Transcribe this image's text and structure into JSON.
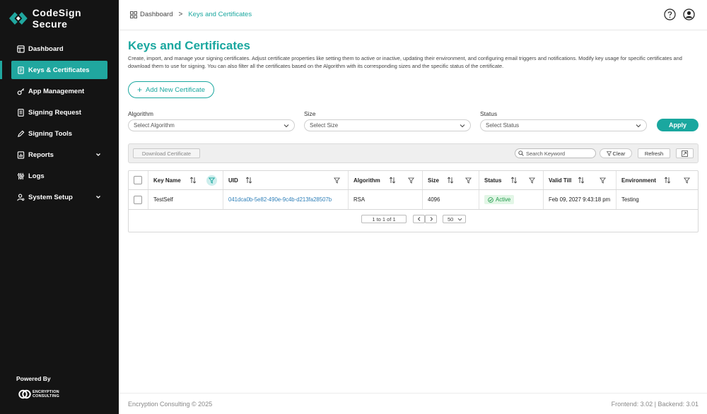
{
  "brand": {
    "name": "CodeSign Secure"
  },
  "sidebar": {
    "items": [
      {
        "label": "Dashboard",
        "icon": "dashboard-icon"
      },
      {
        "label": "Keys & Certificates",
        "icon": "keys-icon",
        "active": true
      },
      {
        "label": "App Management",
        "icon": "key-icon"
      },
      {
        "label": "Signing Request",
        "icon": "document-icon"
      },
      {
        "label": "Signing Tools",
        "icon": "pen-icon"
      },
      {
        "label": "Reports",
        "icon": "chart-icon",
        "expandable": true
      },
      {
        "label": "Logs",
        "icon": "logs-icon"
      },
      {
        "label": "System Setup",
        "icon": "user-gear-icon",
        "expandable": true
      }
    ],
    "powered_by": "Powered By",
    "partner_logo": {
      "line1": "ENCRYPTION",
      "line2": "CONSULTING"
    }
  },
  "breadcrumb": {
    "home": "Dashboard",
    "separator": ">",
    "current": "Keys and Certificates"
  },
  "page": {
    "title": "Keys and Certificates",
    "description": "Create, import, and manage your signing certificates. Adjust certificate properties like setting them to active or inactive, updating their environment, and configuring email triggers and notifications. Modify key usage for specific certificates and download them to use for signing. You can also filter all the certificates based on the Algorithm with its corresponding sizes and the specific status of the certificate.",
    "add_button": "Add New Certificate"
  },
  "filters": {
    "algorithm": {
      "label": "Algorithm",
      "placeholder": "Select Algorithm"
    },
    "size": {
      "label": "Size",
      "placeholder": "Select Size"
    },
    "status": {
      "label": "Status",
      "placeholder": "Select Status"
    },
    "apply": "Apply"
  },
  "toolbar": {
    "download": "Download Certificate",
    "search_placeholder": "Search Keyword",
    "clear": "Clear",
    "refresh": "Refresh"
  },
  "table": {
    "columns": [
      "Key Name",
      "UID",
      "Algorithm",
      "Size",
      "Status",
      "Valid Till",
      "Environment"
    ],
    "rows": [
      {
        "key_name": "TestSelf",
        "uid": "041dca0b-5e82-490e-9c4b-d213fa28507b",
        "algorithm": "RSA",
        "size": "4096",
        "status": "Active",
        "valid_till": "Feb 09, 2027 9:43:18 pm",
        "environment": "Testing"
      }
    ]
  },
  "pagination": {
    "summary": "1 to 1 of 1",
    "prev": "<",
    "next": ">",
    "page_size": "50"
  },
  "footer": {
    "copyright": "Encryption Consulting © 2025",
    "versions": "Frontend: 3.02  |  Backend: 3.01"
  },
  "colors": {
    "accent": "#1aa79f",
    "sidebar_bg": "#141414",
    "active_badge": "#1e9a4a"
  }
}
